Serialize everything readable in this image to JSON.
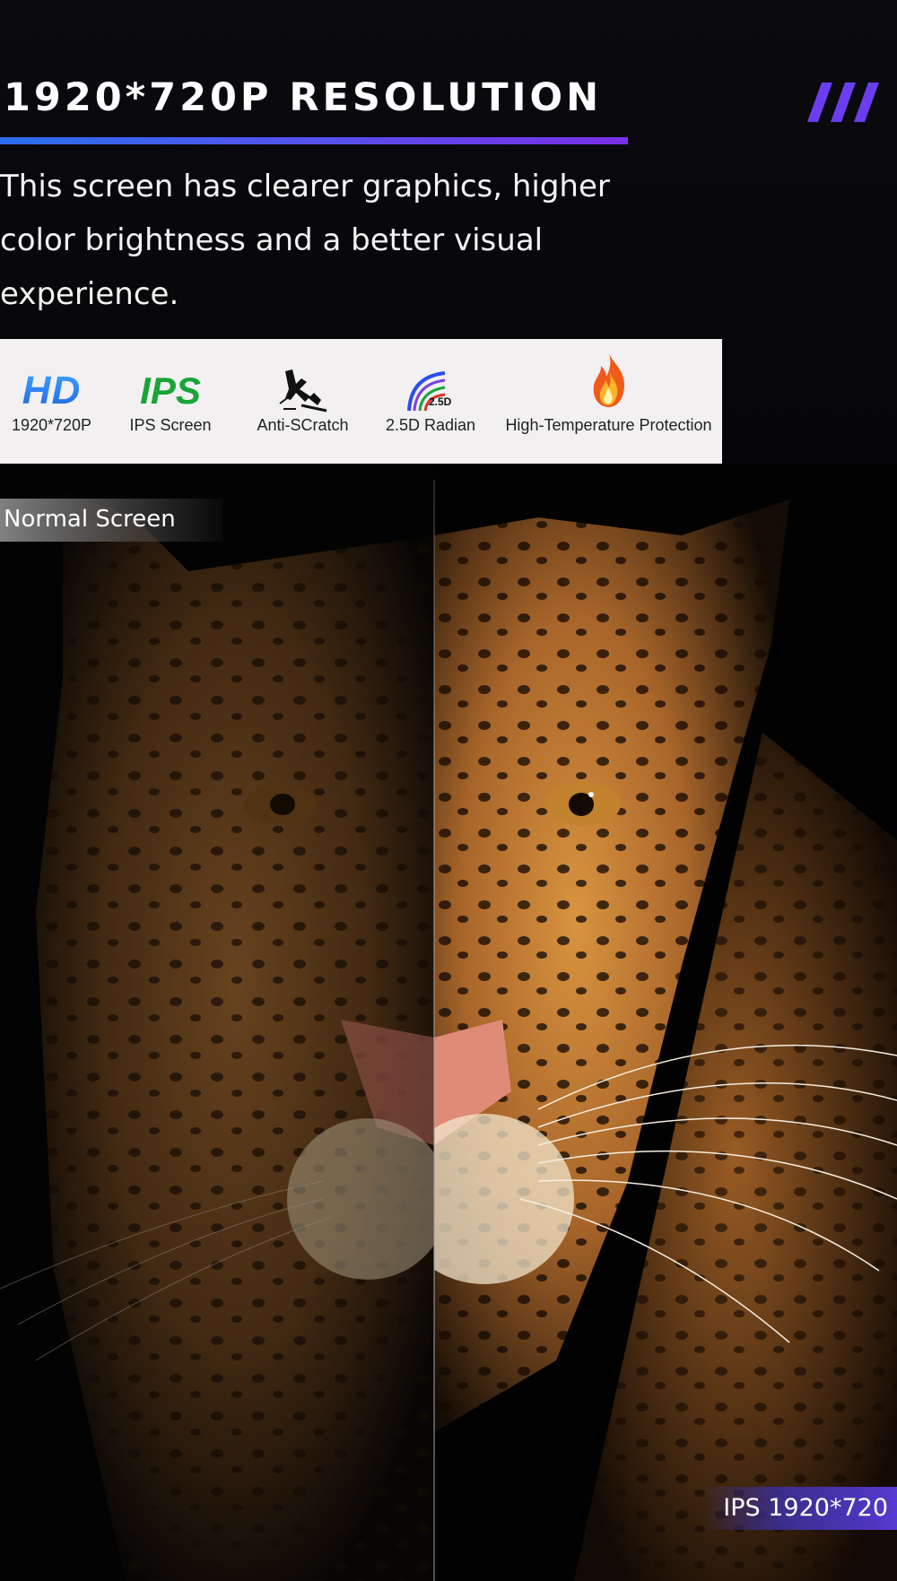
{
  "header": {
    "title": "1920*720P RESOLUTION",
    "description": "This screen has clearer graphics, higher color brightness and a better visual experience."
  },
  "features": [
    {
      "icon": "hd-icon",
      "icon_text": "HD",
      "label": "1920*720P"
    },
    {
      "icon": "ips-icon",
      "icon_text": "IPS",
      "label": "IPS Screen"
    },
    {
      "icon": "anti-scratch-icon",
      "label": "Anti-SCratch"
    },
    {
      "icon": "radian-icon",
      "icon_text": "2.5D",
      "label": "2.5D Radian"
    },
    {
      "icon": "flame-icon",
      "label": "High-Temperature Protection"
    }
  ],
  "comparison": {
    "left_label": "Normal Screen",
    "right_label": "IPS 1920*720"
  },
  "colors": {
    "accent_blue": "#2a6df2",
    "accent_purple": "#7a2fe6",
    "hd_blue": "#1a5fe0",
    "ips_green": "#1aa438",
    "flame_orange": "#f05a1a"
  }
}
